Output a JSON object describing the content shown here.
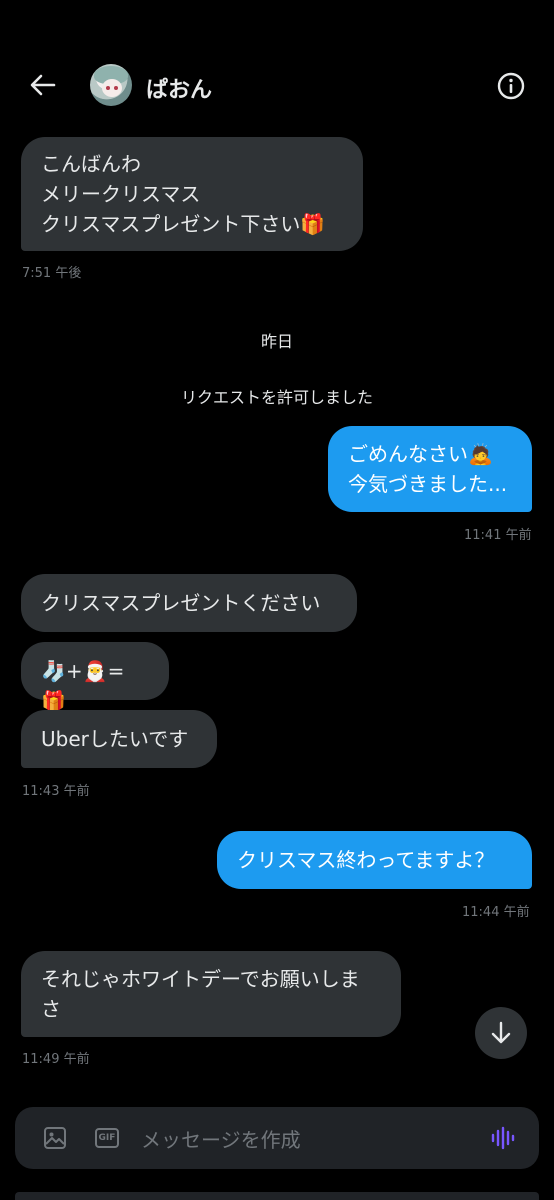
{
  "header": {
    "contact_name": "ぱおん"
  },
  "messages": {
    "m1": {
      "lines": [
        "こんばんわ",
        "メリークリスマス",
        "クリスマスプレゼント下さい🎁"
      ]
    },
    "m1_time": "7:51 午後",
    "date_divider": "昨日",
    "request_notice": "リクエストを許可しました",
    "m2": {
      "lines": [
        "ごめんなさい🙇",
        "今気づきました..."
      ]
    },
    "m2_time": "11:41 午前",
    "m3": "クリスマスプレゼントください",
    "m4": "🧦+🎅=🎁",
    "m5": "Uberしたいです",
    "m5_time": "11:43 午前",
    "m6": "クリスマス終わってますよ？",
    "m6_time": "11:44 午前",
    "m7": {
      "lines": [
        "それじゃホワイトデーでお願いしま",
        "さ"
      ]
    },
    "m7_time": "11:49 午前"
  },
  "composer": {
    "placeholder": "メッセージを作成",
    "gif_label": "GIF"
  },
  "colors": {
    "background": "#000000",
    "incoming_bubble": "#2f3336",
    "outgoing_bubble": "#1d9bf0",
    "timestamp": "#71767b",
    "voice_icon": "#7856ff"
  },
  "icons": [
    "back-arrow-icon",
    "info-icon",
    "scroll-down-icon",
    "image-icon",
    "gif-icon",
    "voice-wave-icon"
  ]
}
